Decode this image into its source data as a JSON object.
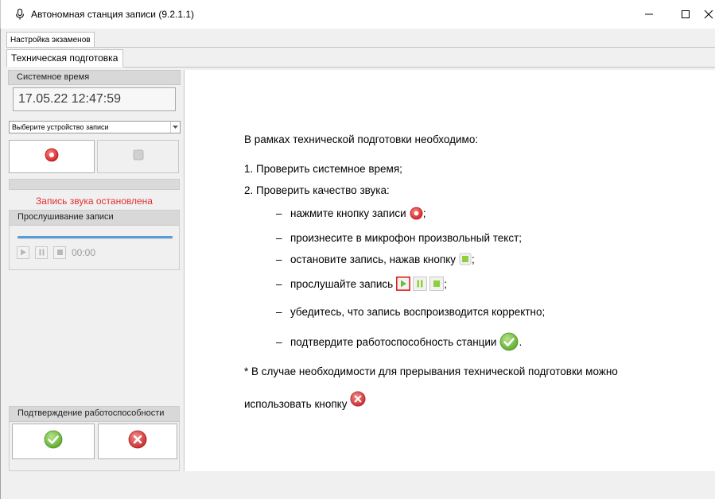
{
  "window": {
    "title": "Автономная станция записи (9.2.1.1)",
    "minimize_label": "–",
    "maximize_label": "☐",
    "close_label": "✕"
  },
  "tabs": {
    "top": "Настройка экзаменов",
    "sub": "Техническая подготовка"
  },
  "left_panel": {
    "system_time_header": "Системное время",
    "system_time_value": "17.05.22 12:47:59",
    "device_select_value": "Выберите устройство записи",
    "status_text": "Запись звука остановлена",
    "status_color": "#e03030",
    "listen_header": "Прослушивание записи",
    "timer": "00:00",
    "confirm_header": "Подтверждение работоспособности"
  },
  "instructions": {
    "intro": "В рамках технической подготовки необходимо:",
    "step1": "1. Проверить системное время;",
    "step2": "2. Проверить качество звука:",
    "bullets": [
      {
        "text": "нажмите кнопку записи",
        "suffix": ";"
      },
      {
        "text": "произнесите в микрофон произвольный текст;",
        "suffix": ""
      },
      {
        "text": "остановите запись, нажав кнопку",
        "suffix": ";"
      },
      {
        "text": "прослушайте запись",
        "suffix": ";"
      },
      {
        "text": "убедитесь, что запись воспроизводится корректно;",
        "suffix": ""
      },
      {
        "text": "подтвердите работоспособность станции",
        "suffix": "."
      }
    ],
    "bullet_dash": "–",
    "note_line1": "* В случае необходимости для прерывания технической подготовки можно",
    "note_line2": "использовать кнопку"
  },
  "colors": {
    "accent_blue": "#5b9bd5",
    "record_red": "#e03030",
    "ok_green": "#6cbb3c",
    "cancel_red": "#d9363e"
  },
  "icons": [
    "microphone-icon",
    "record-icon",
    "stop-icon",
    "play-icon",
    "pause-icon",
    "check-icon",
    "cancel-icon"
  ]
}
